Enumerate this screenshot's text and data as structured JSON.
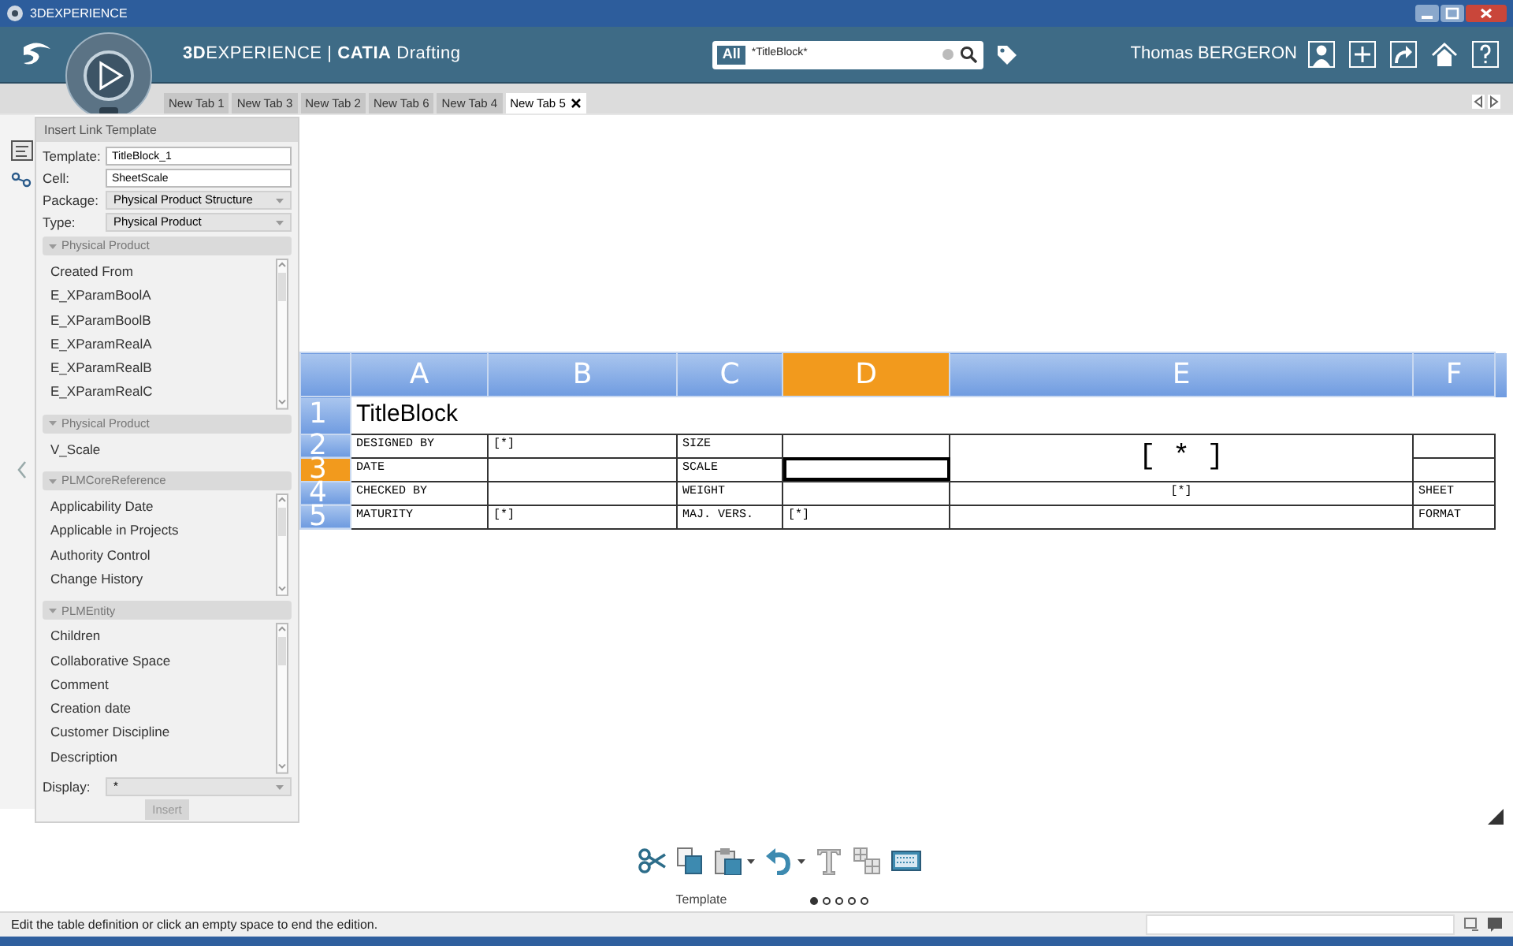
{
  "window": {
    "title": "3DEXPERIENCE"
  },
  "header": {
    "app_title": "**3D**EXPERIENCE | **CATIA** Drafting",
    "search": {
      "scope": "All",
      "value": "*TitleBlock*"
    },
    "user": "Thomas BERGERON"
  },
  "tabs": [
    {
      "label": "New Tab 1",
      "selected": false
    },
    {
      "label": "New Tab 3",
      "selected": false
    },
    {
      "label": "New Tab 2",
      "selected": false
    },
    {
      "label": "New Tab 6",
      "selected": false
    },
    {
      "label": "New Tab 4",
      "selected": false
    },
    {
      "label": "New Tab 5",
      "selected": true
    }
  ],
  "panel": {
    "title": "Insert Link Template",
    "fields": [
      {
        "label": "Template:",
        "value": "TitleBlock_1",
        "kind": "text"
      },
      {
        "label": "Cell:",
        "value": "SheetScale",
        "kind": "text"
      },
      {
        "label": "Package:",
        "value": "Physical Product Structure",
        "kind": "dropdown"
      },
      {
        "label": "Type:",
        "value": "Physical Product",
        "kind": "dropdown"
      }
    ],
    "sections": [
      {
        "title": "Physical Product",
        "scrollbar": true,
        "items": [
          "Created From",
          "E_XParamBoolA",
          "E_XParamBoolB",
          "E_XParamRealA",
          "E_XParamRealB",
          "E_XParamRealC"
        ]
      },
      {
        "title": "Physical Product",
        "scrollbar": false,
        "items": [
          "V_Scale"
        ]
      },
      {
        "title": "PLMCoreReference",
        "scrollbar": true,
        "items": [
          "Applicability Date",
          "Applicable in Projects",
          "Authority Control",
          "Change History"
        ]
      },
      {
        "title": "PLMEntity",
        "scrollbar": true,
        "items": [
          "Children",
          "Collaborative Space",
          "Comment",
          "Creation date",
          "Customer Discipline",
          "Description"
        ]
      }
    ],
    "display": {
      "label": "Display:",
      "value": "*"
    },
    "button": {
      "label": "Insert",
      "disabled": true
    }
  },
  "table": {
    "columns": [
      {
        "label": "A",
        "selected": false
      },
      {
        "label": "B",
        "selected": false
      },
      {
        "label": "C",
        "selected": false
      },
      {
        "label": "D",
        "selected": true
      },
      {
        "label": "E",
        "selected": false
      },
      {
        "label": "F",
        "selected": false
      }
    ],
    "rows": [
      {
        "label": "1",
        "selected": false,
        "cells": [
          {
            "text": "TitleBlock",
            "title": true
          },
          {
            "text": ""
          },
          {
            "text": ""
          },
          {
            "text": ""
          },
          {
            "text": ""
          },
          {
            "text": ""
          }
        ]
      },
      {
        "label": "2",
        "selected": false,
        "cells": [
          {
            "text": "DESIGNED BY"
          },
          {
            "text": "[*]"
          },
          {
            "text": "SIZE"
          },
          {
            "text": ""
          },
          {
            "text": "[ * ]",
            "rowspan": 2
          },
          {
            "text": ""
          }
        ]
      },
      {
        "label": "3",
        "selected": true,
        "cells": [
          {
            "text": "DATE"
          },
          {
            "text": ""
          },
          {
            "text": "SCALE"
          },
          {
            "text": "",
            "active": true
          },
          {
            "text": ""
          }
        ]
      },
      {
        "label": "4",
        "selected": false,
        "cells": [
          {
            "text": "CHECKED BY"
          },
          {
            "text": ""
          },
          {
            "text": "WEIGHT"
          },
          {
            "text": ""
          },
          {
            "text": "[*]"
          },
          {
            "text": "SHEET"
          }
        ]
      },
      {
        "label": "5",
        "selected": false,
        "cells": [
          {
            "text": "MATURITY"
          },
          {
            "text": "[*]"
          },
          {
            "text": "MAJ. VERS."
          },
          {
            "text": "[*]"
          },
          {
            "text": ""
          },
          {
            "text": "FORMAT"
          }
        ]
      }
    ]
  },
  "toolbar": {
    "tools": [
      {
        "kind": "cut"
      },
      {
        "kind": "copy"
      },
      {
        "kind": "paste"
      },
      {
        "kind": "caret"
      },
      {
        "kind": "undo"
      },
      {
        "kind": "caret"
      },
      {
        "kind": "text"
      },
      {
        "kind": "grid"
      },
      {
        "kind": "screen"
      }
    ],
    "label": "Template",
    "pages": [
      {
        "selected": true
      },
      {
        "selected": false
      },
      {
        "selected": false
      },
      {
        "selected": false
      },
      {
        "selected": false
      }
    ]
  },
  "status_bar": {
    "message": "Edit the table definition or click an empty space to end the edition."
  }
}
